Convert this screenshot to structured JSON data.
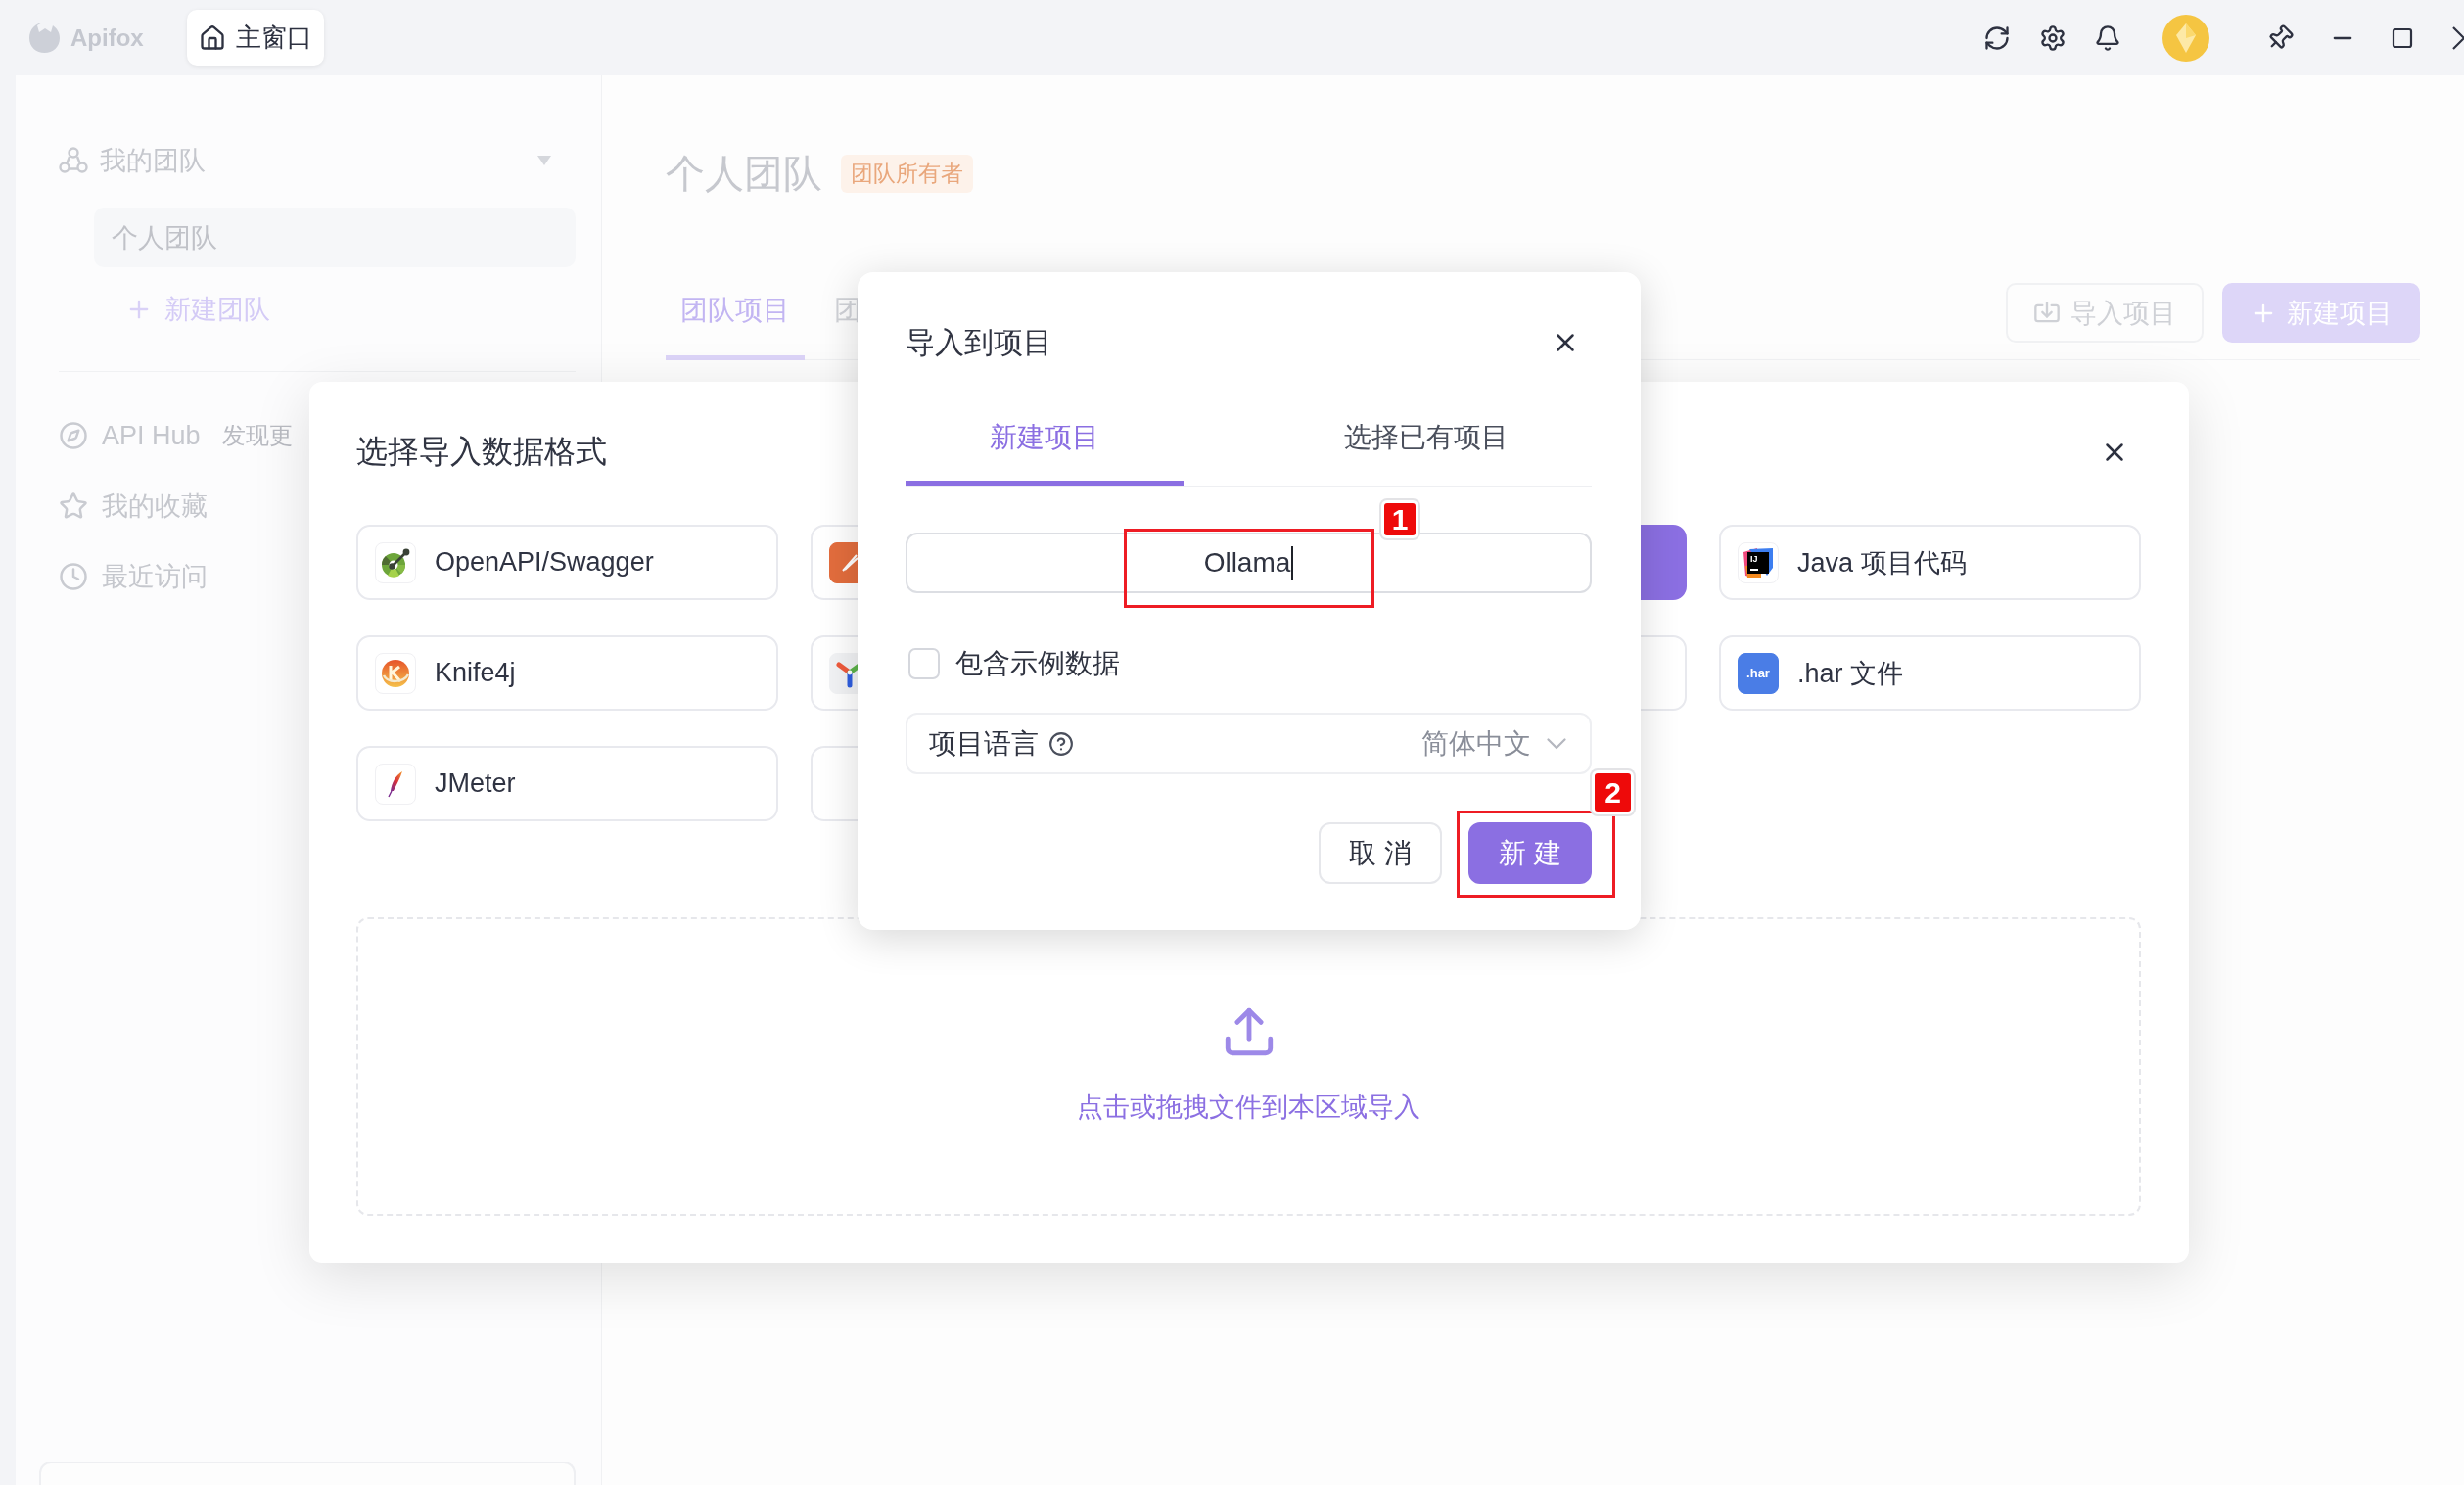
{
  "window": {
    "app_name": "Apifox",
    "tabs": [
      {
        "label": "主窗口",
        "selected": true
      }
    ]
  },
  "sidebar": {
    "team_header": "我的团队",
    "teams": [
      {
        "label": "个人团队",
        "selected": true
      }
    ],
    "new_team": "新建团队",
    "nav": [
      {
        "label": "API Hub",
        "hint": "发现更"
      },
      {
        "label": "我的收藏"
      },
      {
        "label": "最近访问"
      }
    ]
  },
  "main": {
    "title": "个人团队",
    "role_badge": "团队所有者",
    "tabs": [
      {
        "label": "团队项目",
        "selected": true
      },
      {
        "label": "团",
        "selected": false
      }
    ],
    "actions": [
      {
        "kind": "outline",
        "label": "导入项目"
      },
      {
        "kind": "primary",
        "label": "新建项目"
      }
    ]
  },
  "format_dialog": {
    "title": "选择导入数据格式",
    "formats": [
      {
        "label": "OpenAPI/Swagger",
        "selected": false
      },
      {
        "selected": false
      },
      {
        "selected": true
      },
      {
        "label": "Java 项目代码",
        "icon_text": "IJ",
        "selected": false
      },
      {
        "label": "Knife4j",
        "selected": false
      },
      {
        "selected": false
      },
      {
        "selected": false
      },
      {
        "label": ".har 文件",
        "icon_text": ".har",
        "selected": false
      },
      {
        "label": "JMeter",
        "selected": false
      },
      {
        "selected": false
      }
    ],
    "drop_zone": "点击或拖拽文件到本区域导入"
  },
  "import_dialog": {
    "title": "导入到项目",
    "tabs": [
      {
        "label": "新建项目",
        "selected": true
      },
      {
        "label": "选择已有项目",
        "selected": false
      }
    ],
    "name_field": {
      "value": "Ollama",
      "annotation": "1"
    },
    "sample_data": {
      "label": "包含示例数据",
      "checked": false
    },
    "language": {
      "label": "项目语言",
      "value": "简体中文"
    },
    "buttons": [
      {
        "kind": "default",
        "label": "取 消"
      },
      {
        "kind": "primary",
        "label": "新 建",
        "annotation": "2"
      }
    ]
  }
}
